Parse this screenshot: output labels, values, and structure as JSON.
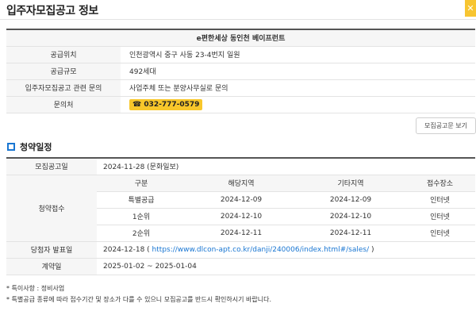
{
  "page": {
    "title": "입주자모집공고 정보",
    "close_glyph": "✕"
  },
  "info": {
    "header": "e편한세상 동인천 베이프런트",
    "rows": [
      {
        "label": "공급위치",
        "value": "인천광역시 중구 사동 23-4번지 일원"
      },
      {
        "label": "공급규모",
        "value": "492세대"
      },
      {
        "label": "입주자모집공고 관련 문의",
        "value": "사업주체 또는 분양사무실로 문의"
      },
      {
        "label": "문의처",
        "value": "☎ 032-777-0579"
      }
    ]
  },
  "doc_button": "모집공고문 보기",
  "schedule": {
    "section_title": "청약일정",
    "notice_label": "모집공고일",
    "notice_value": "2024-11-28 (문화일보)",
    "apply_label": "청약접수",
    "columns": [
      "구분",
      "해당지역",
      "기타지역",
      "접수장소"
    ],
    "rows": [
      [
        "특별공급",
        "2024-12-09",
        "2024-12-09",
        "인터넷"
      ],
      [
        "1순위",
        "2024-12-10",
        "2024-12-10",
        "인터넷"
      ],
      [
        "2순위",
        "2024-12-11",
        "2024-12-11",
        "인터넷"
      ]
    ],
    "winner_label": "당첨자 발표일",
    "winner_date": "2024-12-18 ( ",
    "winner_link": "https://www.dlcon-apt.co.kr/danji/240006/index.html#/sales/",
    "winner_suffix": " )",
    "contract_label": "계약일",
    "contract_value": "2025-01-02 ~ 2025-01-04"
  },
  "notes": [
    "* 특이사항 : 정비사업",
    "* 특별공급 종류에 따라 접수기간 및 장소가 다를 수 있으니 모집공고를 반드시 확인하시기 바랍니다."
  ],
  "colors": {
    "accent": "#f8c72b",
    "link": "#1976d2",
    "section_icon": "#1976d2"
  }
}
